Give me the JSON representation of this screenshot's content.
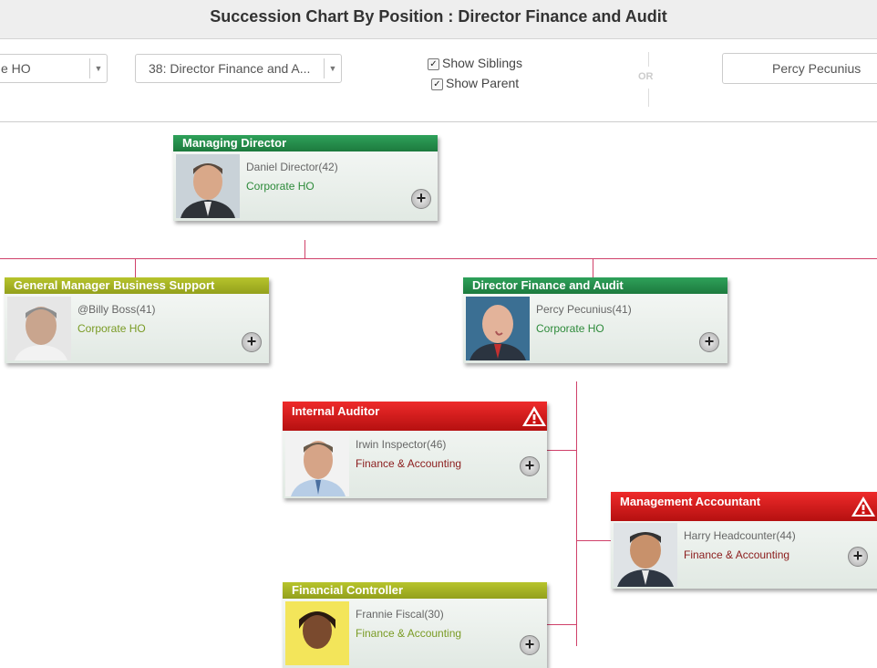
{
  "title": "Succession Chart By Position : Director Finance and Audit",
  "toolbar": {
    "location_value": "e HO",
    "position_value": "38: Director Finance and A...",
    "show_siblings_label": "Show Siblings",
    "show_siblings_checked": true,
    "show_parent_label": "Show Parent",
    "show_parent_checked": true,
    "or_label": "OR",
    "person_value": "Percy Pecunius"
  },
  "cards": [
    {
      "id": "managing-director",
      "title": "Managing Director",
      "name": "Daniel Director(42)",
      "dept": "Corporate HO",
      "color": "green",
      "warning": false
    },
    {
      "id": "gm-business-support",
      "title": "General Manager Business Support",
      "name": "@Billy Boss(41)",
      "dept": "Corporate HO",
      "color": "olive",
      "warning": false
    },
    {
      "id": "director-finance-audit",
      "title": "Director Finance and Audit",
      "name": "Percy Pecunius(41)",
      "dept": "Corporate HO",
      "color": "green",
      "warning": false
    },
    {
      "id": "internal-auditor",
      "title": "Internal Auditor",
      "name": "Irwin Inspector(46)",
      "dept": "Finance & Accounting",
      "color": "red",
      "warning": true
    },
    {
      "id": "management-accountant",
      "title": "Management Accountant",
      "name": "Harry Headcounter(44)",
      "dept": "Finance & Accounting",
      "color": "red",
      "warning": true
    },
    {
      "id": "financial-controller",
      "title": "Financial Controller",
      "name": "Frannie Fiscal(30)",
      "dept": "Finance & Accounting",
      "color": "olive",
      "warning": false
    }
  ],
  "icons": {
    "expand": "plus-icon",
    "warning": "warning-triangle-icon",
    "dropdown": "chevron-down-icon"
  },
  "colors": {
    "green": "#2a9451",
    "olive": "#a9b626",
    "red": "#d41f1f",
    "connector": "#d0416a"
  }
}
